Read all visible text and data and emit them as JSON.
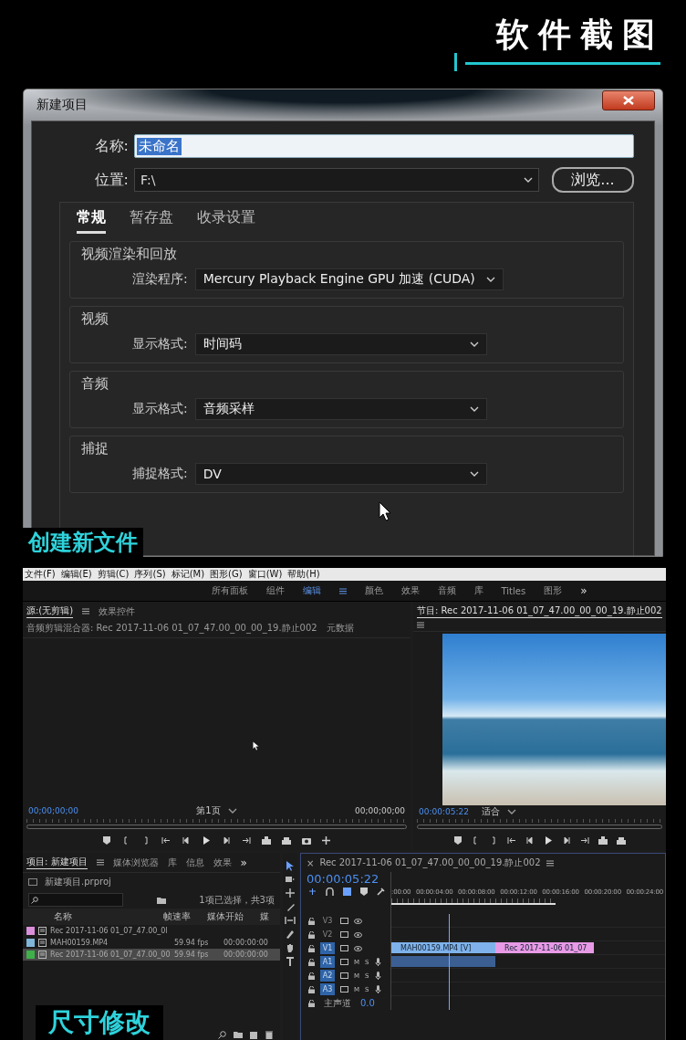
{
  "banner": {
    "title": "软件截图"
  },
  "dialog": {
    "title": "新建项目",
    "name_label": "名称:",
    "name_value": "未命名",
    "location_label": "位置:",
    "location_value": "F:\\",
    "browse_button": "浏览...",
    "tabs": [
      {
        "label": "常规",
        "selected": true
      },
      {
        "label": "暂存盘",
        "selected": false
      },
      {
        "label": "收录设置",
        "selected": false
      }
    ],
    "sections": [
      {
        "title": "视频渲染和回放",
        "label": "渲染程序:",
        "value": "Mercury Playback Engine GPU 加速 (CUDA)"
      },
      {
        "title": "视频",
        "label": "显示格式:",
        "value": "时间码"
      },
      {
        "title": "音频",
        "label": "显示格式:",
        "value": "音频采样"
      },
      {
        "title": "捕捉",
        "label": "捕捉格式:",
        "value": "DV"
      }
    ],
    "caption": "创建新文件"
  },
  "premiere": {
    "menu": [
      "文件(F)",
      "编辑(E)",
      "剪辑(C)",
      "序列(S)",
      "标记(M)",
      "图形(G)",
      "窗口(W)",
      "帮助(H)"
    ],
    "workspaces": [
      {
        "label": "所有面板",
        "selected": false
      },
      {
        "label": "组件",
        "selected": false
      },
      {
        "label": "编辑",
        "selected": true
      },
      {
        "label": "颜色",
        "selected": false
      },
      {
        "label": "效果",
        "selected": false
      },
      {
        "label": "音频",
        "selected": false
      },
      {
        "label": "库",
        "selected": false
      },
      {
        "label": "Titles",
        "selected": false
      },
      {
        "label": "图形",
        "selected": false
      }
    ],
    "workspace_more": "»",
    "source_tabs": [
      {
        "label": "源:(无剪辑)",
        "selected": true
      },
      {
        "label": "效果控件",
        "selected": false
      },
      {
        "label": "音频剪辑混合器: Rec 2017-11-06 01_07_47.00_00_00_19.静止002",
        "selected": false
      },
      {
        "label": "元数据",
        "selected": false
      }
    ],
    "source_monitor": {
      "timecode_in": "00;00;00;00",
      "page": "第1页",
      "timecode_out": "00;00;00;00"
    },
    "program_monitor": {
      "tab": "节目: Rec 2017-11-06 01_07_47.00_00_00_19.静止002",
      "timecode": "00:00:05:22",
      "zoom": "适合"
    },
    "project_tabs": [
      {
        "label": "项目: 新建项目",
        "selected": true
      },
      {
        "label": "媒体浏览器",
        "selected": false
      },
      {
        "label": "库",
        "selected": false
      },
      {
        "label": "信息",
        "selected": false
      },
      {
        "label": "效果",
        "selected": false
      }
    ],
    "project_more": "»",
    "project": {
      "file": "新建项目.prproj",
      "selection_info": "1项已选择，共3项",
      "columns": [
        "名称",
        "帧速率",
        "媒体开始",
        "媒"
      ],
      "rows": [
        {
          "color": "#d98fd9",
          "name": "Rec 2017-11-06 01_07_47.00_0l",
          "selected": false
        },
        {
          "color": "#7fb6d9",
          "name": "MAH00159.MP4",
          "frame_rate": "59.94 fps",
          "start": "00:00:00:00",
          "selected": false
        },
        {
          "color": "#3fb04a",
          "name": "Rec 2017-11-06 01_07_47.00_00",
          "frame_rate": "59.94 fps",
          "start": "00:00:00:00",
          "selected": true
        }
      ]
    },
    "timeline": {
      "close": "×",
      "tab": "Rec 2017-11-06 01_07_47.00_00_00_19.静止002",
      "timecode": "00:00:05:22",
      "ruler": [
        ":00:00",
        "00:00:04:00",
        "00:00:08:00",
        "00:00:12:00",
        "00:00:16:00",
        "00:00:20:00",
        "00:00:24:00"
      ],
      "tracks": [
        {
          "kind": "video",
          "label": "V3",
          "targeted": false
        },
        {
          "kind": "video",
          "label": "V2",
          "targeted": false
        },
        {
          "kind": "video",
          "label": "V1",
          "targeted": true
        },
        {
          "kind": "audio",
          "label": "A1",
          "targeted": true,
          "mute": "M",
          "solo": "S"
        },
        {
          "kind": "audio",
          "label": "A2",
          "targeted": true,
          "mute": "M",
          "solo": "S"
        },
        {
          "kind": "audio",
          "label": "A3",
          "targeted": true,
          "mute": "M",
          "solo": "S"
        }
      ],
      "master": {
        "label": "主声道",
        "value": "0.0"
      },
      "clips": [
        {
          "kind": "video",
          "label": "MAH00159.MP4 [V]",
          "color": "#7fb2ea"
        },
        {
          "kind": "video",
          "label": "Rec 2017-11-06 01_07",
          "color": "#e89ae6"
        },
        {
          "kind": "audio",
          "color": "#3b5f93"
        }
      ]
    },
    "caption": "尺寸修改"
  }
}
